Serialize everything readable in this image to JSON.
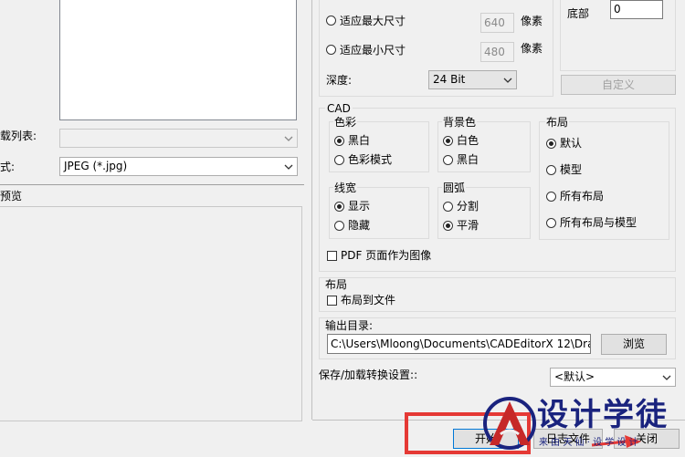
{
  "left": {
    "load_list_label": "载列表:",
    "format_label": "式:",
    "format_value": "JPEG (*.jpg)",
    "preview_label": "预览"
  },
  "size": {
    "fit_max_label": "适应最大尺寸",
    "fit_max_value": "640",
    "fit_min_label": "适应最小尺寸",
    "fit_min_value": "480",
    "pixel_unit": "像素",
    "depth_label": "深度:",
    "depth_value": "24 Bit",
    "bottom_label": "底部",
    "bottom_value": "0",
    "custom_button": "自定义"
  },
  "cad": {
    "title": "CAD",
    "color": {
      "title": "色彩",
      "options": [
        "黑白",
        "色彩模式"
      ],
      "selected": 0
    },
    "background": {
      "title": "背景色",
      "options": [
        "白色",
        "黑白"
      ],
      "selected": 0
    },
    "layout": {
      "title": "布局",
      "options": [
        "默认",
        "模型",
        "所有布局",
        "所有布局与模型"
      ],
      "selected": 0
    },
    "lineweight": {
      "title": "线宽",
      "options": [
        "显示",
        "隐藏"
      ],
      "selected": 0
    },
    "arc": {
      "title": "圆弧",
      "options": [
        "分割",
        "平滑"
      ],
      "selected": 1
    },
    "pdf_label": "PDF 页面作为图像"
  },
  "layout_group": {
    "title": "布局",
    "to_file_label": "布局到文件"
  },
  "output": {
    "label": "输出目录:",
    "path": "C:\\Users\\Mloong\\Documents\\CADEditorX 12\\Drawin",
    "browse_button": "浏览"
  },
  "settings": {
    "label": "保存/加载转换设置::",
    "value": "<默认>"
  },
  "footer": {
    "start_button": "开始",
    "log_button": "日志文件",
    "close_button": "关闭"
  },
  "watermark": {
    "logo_text": "设计学徒",
    "sub_text": "来 由 天 仙 · 设 学 设 计"
  },
  "colors": {
    "highlight_box": "#e53935",
    "watermark_red": "#c62828",
    "watermark_blue": "#1a237e"
  }
}
